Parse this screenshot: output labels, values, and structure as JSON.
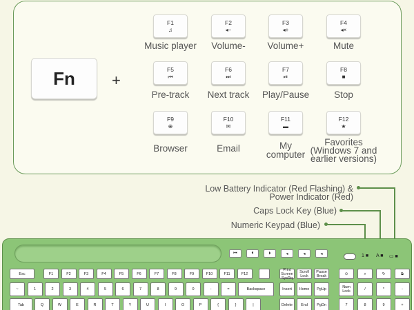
{
  "fn": {
    "label": "Fn",
    "plus": "+"
  },
  "fkeys": [
    {
      "key": "F1",
      "icon": "♫",
      "icon_name": "music-note-icon",
      "label": "Music player"
    },
    {
      "key": "F2",
      "icon": "◂−",
      "icon_name": "volume-down-icon",
      "label": "Volume-"
    },
    {
      "key": "F3",
      "icon": "◂+",
      "icon_name": "volume-up-icon",
      "label": "Volume+"
    },
    {
      "key": "F4",
      "icon": "◂×",
      "icon_name": "mute-icon",
      "label": "Mute"
    },
    {
      "key": "F5",
      "icon": "⏮",
      "icon_name": "previous-track-icon",
      "label": "Pre-track"
    },
    {
      "key": "F6",
      "icon": "⏭",
      "icon_name": "next-track-icon",
      "label": "Next track"
    },
    {
      "key": "F7",
      "icon": "⏯",
      "icon_name": "play-pause-icon",
      "label": "Play/Pause"
    },
    {
      "key": "F8",
      "icon": "■",
      "icon_name": "stop-icon",
      "label": "Stop"
    },
    {
      "key": "F9",
      "icon": "⊕",
      "icon_name": "browser-globe-icon",
      "label": "Browser"
    },
    {
      "key": "F10",
      "icon": "✉",
      "icon_name": "email-icon",
      "label": "Email"
    },
    {
      "key": "F11",
      "icon": "▬",
      "icon_name": "computer-monitor-icon",
      "label": "My computer"
    },
    {
      "key": "F12",
      "icon": "★",
      "icon_name": "favorites-star-icon",
      "label": "Favorites (Windows 7 and earlier versions)"
    }
  ],
  "annotations": {
    "battery": "Low Battery Indicator (Red Flashing) & Power Indicator (Red)",
    "caps": "Caps Lock Key (Blue)",
    "numpad": "Numeric Keypad (Blue)"
  },
  "keyboard": {
    "media_keys": [
      "⏮",
      "⏴",
      "⏵",
      "◂",
      "◂",
      "◂"
    ],
    "esc": "Esc",
    "frow": [
      "F1",
      "F2",
      "F3",
      "F4",
      "F5",
      "F6",
      "F7",
      "F8",
      "F9",
      "F10",
      "F11",
      "F12"
    ],
    "nav_top": [
      "Print Screen SysRq",
      "Scroll Lock",
      "Pause Break"
    ],
    "numrow": [
      "~",
      "1",
      "2",
      "3",
      "4",
      "5",
      "6",
      "7",
      "8",
      "9",
      "0",
      "-",
      "=",
      "Backspace"
    ],
    "nav_mid": [
      "Insert",
      "Home",
      "PgUp"
    ],
    "num_top": [
      "Num Lock",
      "/",
      "*",
      "-"
    ],
    "qrow": [
      "Tab",
      "Q",
      "W",
      "E",
      "R",
      "T",
      "Y",
      "U",
      "I",
      "O",
      "P",
      "{",
      "}",
      "|"
    ],
    "nav_low": [
      "Delete",
      "End",
      "PgDn"
    ],
    "num_mid": [
      "7",
      "8",
      "9",
      "+"
    ],
    "indicators": [
      "1 ■",
      "A ■",
      "▭ ■"
    ]
  },
  "colors": {
    "keyboard": "#8cc577",
    "accent": "#5d8f4a",
    "card_border": "#6a9a5a"
  }
}
